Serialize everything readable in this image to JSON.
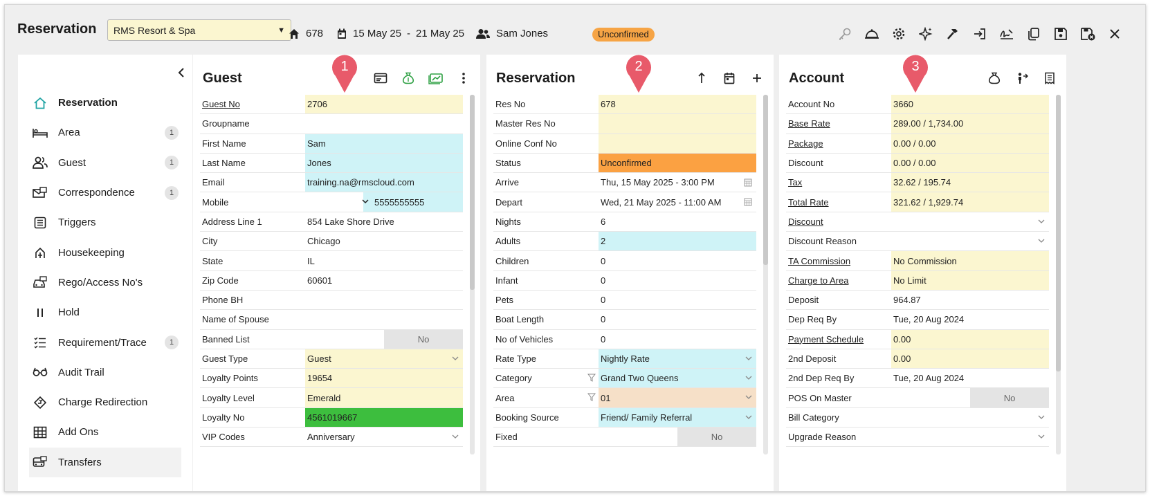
{
  "header": {
    "title": "Reservation",
    "property": "RMS Resort & Spa",
    "res_no": "678",
    "date_from": "15 May 25",
    "date_sep": "-",
    "date_to": "21 May 25",
    "guest_name": "Sam Jones",
    "status_badge": "Unconfirmed"
  },
  "colors": {
    "badge": "#f6a445",
    "pin": "#e85a6a",
    "accent_teal": "#1fa3a3",
    "loyalty_green": "#3dbe3e",
    "status_orange": "#fba142"
  },
  "toolbar_icons": [
    "key-icon",
    "bell-icon",
    "settings-icon",
    "sparkle-icon",
    "hammer-icon",
    "check-in-icon",
    "signature-icon",
    "copy-icon",
    "save-icon",
    "save-close-icon",
    "close-icon"
  ],
  "sidebar": {
    "items": [
      {
        "label": "Reservation",
        "icon": "home-icon",
        "count": ""
      },
      {
        "label": "Area",
        "icon": "bed-icon",
        "count": "1"
      },
      {
        "label": "Guest",
        "icon": "users-icon",
        "count": "1"
      },
      {
        "label": "Correspondence",
        "icon": "mail-icon",
        "count": "1"
      },
      {
        "label": "Triggers",
        "icon": "triggers-icon",
        "count": ""
      },
      {
        "label": "Housekeeping",
        "icon": "housekeeping-icon",
        "count": ""
      },
      {
        "label": "Rego/Access No's",
        "icon": "car-icon",
        "count": ""
      },
      {
        "label": "Hold",
        "icon": "pause-icon",
        "count": ""
      },
      {
        "label": "Requirement/Trace",
        "icon": "checklist-icon",
        "count": "1"
      },
      {
        "label": "Audit Trail",
        "icon": "glasses-icon",
        "count": ""
      },
      {
        "label": "Charge Redirection",
        "icon": "redirect-icon",
        "count": ""
      },
      {
        "label": "Add Ons",
        "icon": "grid-icon",
        "count": ""
      },
      {
        "label": "Transfers",
        "icon": "bus-icon",
        "count": ""
      }
    ]
  },
  "pins": [
    "1",
    "2",
    "3"
  ],
  "guest": {
    "title": "Guest",
    "rows": [
      {
        "k": "Guest No",
        "v": "2706"
      },
      {
        "k": "Groupname",
        "v": ""
      },
      {
        "k": "First Name",
        "v": "Sam"
      },
      {
        "k": "Last Name",
        "v": "Jones"
      },
      {
        "k": "Email",
        "v": "training.na@rmscloud.com"
      },
      {
        "k": "Mobile",
        "v": "5555555555"
      },
      {
        "k": "Address Line 1",
        "v": "854 Lake Shore Drive"
      },
      {
        "k": "City",
        "v": "Chicago"
      },
      {
        "k": "State",
        "v": "IL"
      },
      {
        "k": "Zip Code",
        "v": "60601"
      },
      {
        "k": "Phone BH",
        "v": ""
      },
      {
        "k": "Name of Spouse",
        "v": ""
      },
      {
        "k": "Banned List",
        "v": "No"
      },
      {
        "k": "Guest Type",
        "v": "Guest"
      },
      {
        "k": "Loyalty Points",
        "v": "19654"
      },
      {
        "k": "Loyalty Level",
        "v": "Emerald"
      },
      {
        "k": "Loyalty No",
        "v": "4561019667"
      },
      {
        "k": "VIP Codes",
        "v": "Anniversary"
      }
    ]
  },
  "reservation": {
    "title": "Reservation",
    "rows": [
      {
        "k": "Res No",
        "v": "678"
      },
      {
        "k": "Master Res No",
        "v": ""
      },
      {
        "k": "Online Conf No",
        "v": ""
      },
      {
        "k": "Status",
        "v": "Unconfirmed"
      },
      {
        "k": "Arrive",
        "v": "Thu, 15 May 2025 - 3:00 PM"
      },
      {
        "k": "Depart",
        "v": "Wed, 21 May 2025 - 11:00 AM"
      },
      {
        "k": "Nights",
        "v": "6"
      },
      {
        "k": "Adults",
        "v": "2"
      },
      {
        "k": "Children",
        "v": "0"
      },
      {
        "k": "Infant",
        "v": "0"
      },
      {
        "k": "Pets",
        "v": "0"
      },
      {
        "k": "Boat Length",
        "v": "0"
      },
      {
        "k": "No of Vehicles",
        "v": "0"
      },
      {
        "k": "Rate Type",
        "v": "Nightly Rate"
      },
      {
        "k": "Category",
        "v": "Grand Two Queens"
      },
      {
        "k": "Area",
        "v": "01"
      },
      {
        "k": "Booking Source",
        "v": "Friend/ Family Referral"
      },
      {
        "k": "Fixed",
        "v": "No"
      }
    ]
  },
  "account": {
    "title": "Account",
    "rows": [
      {
        "k": "Account No",
        "v": "3660"
      },
      {
        "k": "Base Rate",
        "v": "289.00 / 1,734.00"
      },
      {
        "k": "Package",
        "v": "0.00 / 0.00"
      },
      {
        "k": "Discount",
        "v": "0.00 / 0.00"
      },
      {
        "k": "Tax",
        "v": "32.62 / 195.74"
      },
      {
        "k": "Total Rate",
        "v": "321.62 / 1,929.74"
      },
      {
        "k": "Discount",
        "v": ""
      },
      {
        "k": "Discount Reason",
        "v": ""
      },
      {
        "k": "TA Commission",
        "v": "No Commission"
      },
      {
        "k": "Charge to Area",
        "v": "No Limit"
      },
      {
        "k": "Deposit",
        "v": "964.87"
      },
      {
        "k": "Dep Req By",
        "v": "Tue, 20 Aug 2024"
      },
      {
        "k": "Payment Schedule",
        "v": "0.00"
      },
      {
        "k": "2nd Deposit",
        "v": "0.00"
      },
      {
        "k": "2nd Dep Req By",
        "v": "Tue, 20 Aug 2024"
      },
      {
        "k": "POS On Master",
        "v": "No"
      },
      {
        "k": "Bill Category",
        "v": ""
      },
      {
        "k": "Upgrade Reason",
        "v": ""
      }
    ]
  }
}
